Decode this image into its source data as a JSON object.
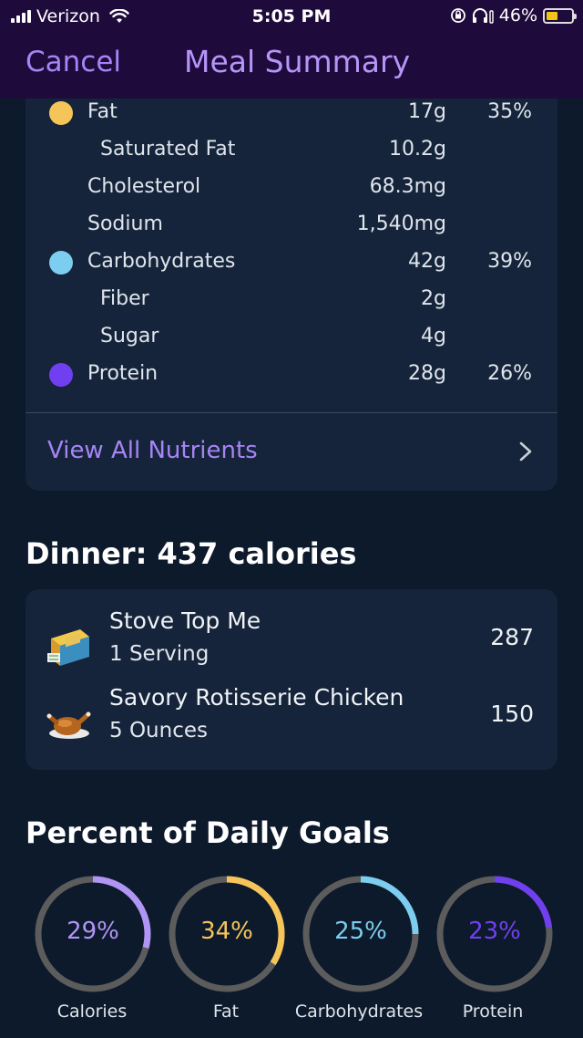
{
  "status": {
    "carrier": "Verizon",
    "time": "5:05 PM",
    "battery": "46%",
    "battery_level": 0.46
  },
  "nav": {
    "cancel_label": "Cancel",
    "title": "Meal Summary"
  },
  "nutrients": [
    {
      "name": "Fat",
      "amount": "17g",
      "pct": "35%",
      "dot_color": "#f6c55a"
    },
    {
      "name": "Saturated Fat",
      "amount": "10.2g",
      "pct": ""
    },
    {
      "name": "Cholesterol",
      "amount": "68.3mg",
      "pct": ""
    },
    {
      "name": "Sodium",
      "amount": "1,540mg",
      "pct": ""
    },
    {
      "name": "Carbohydrates",
      "amount": "42g",
      "pct": "39%",
      "dot_color": "#7ccdf0"
    },
    {
      "name": "Fiber",
      "amount": "2g",
      "pct": ""
    },
    {
      "name": "Sugar",
      "amount": "4g",
      "pct": ""
    },
    {
      "name": "Protein",
      "amount": "28g",
      "pct": "26%",
      "dot_color": "#7040f0"
    }
  ],
  "view_all_label": "View All Nutrients",
  "dinner": {
    "title": "Dinner: 437 calories",
    "items": [
      {
        "name": "Stove Top Me",
        "serving": "1 Serving",
        "calories": "287",
        "icon": "stuffing-box-icon"
      },
      {
        "name": "Savory Rotisserie Chicken",
        "serving": "5 Ounces",
        "calories": "150",
        "icon": "roast-chicken-icon"
      }
    ]
  },
  "daily_goals": {
    "title": "Percent of Daily Goals",
    "rings": [
      {
        "pct": "29%",
        "value": 0.29,
        "label": "Calories",
        "color": "#b195f5"
      },
      {
        "pct": "34%",
        "value": 0.34,
        "label": "Fat",
        "color": "#f6c55a"
      },
      {
        "pct": "25%",
        "value": 0.25,
        "label": "Carbohydrates",
        "color": "#7ccdf0"
      },
      {
        "pct": "23%",
        "value": 0.23,
        "label": "Protein",
        "color": "#7040f0"
      }
    ]
  },
  "colors": {
    "accent": "#a784f5",
    "header_bg": "#1f0a3c",
    "card_bg": "#15243a",
    "page_bg": "#0d1a2b",
    "ring_track": "#5c5c5c"
  }
}
